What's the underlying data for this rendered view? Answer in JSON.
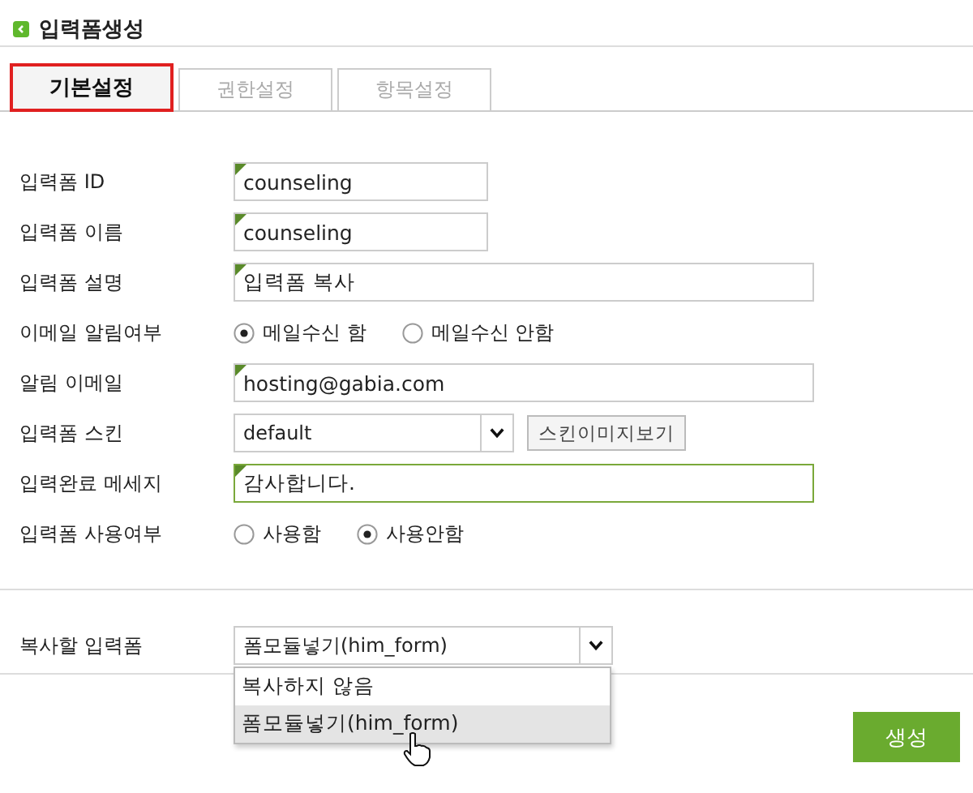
{
  "title": "입력폼생성",
  "tabs": [
    {
      "label": "기본설정",
      "selected": true
    },
    {
      "label": "권한설정",
      "selected": false
    },
    {
      "label": "항목설정",
      "selected": false
    }
  ],
  "fields": [
    {
      "kind": "short",
      "label": "입력폼 ID",
      "value": "counseling",
      "focused": false
    },
    {
      "kind": "short",
      "label": "입력폼 이름",
      "value": "counseling",
      "focused": false
    },
    {
      "kind": "long",
      "label": "입력폼 설명",
      "value": "입력폼 복사",
      "focused": false
    },
    {
      "kind": "radio",
      "label": "이메일 알림여부",
      "options": [
        {
          "label": "메일수신 함",
          "selected": true
        },
        {
          "label": "메일수신 안함",
          "selected": false
        }
      ]
    },
    {
      "kind": "long",
      "label": "알림 이메일",
      "value": "hosting@gabia.com",
      "focused": false
    },
    {
      "kind": "select",
      "label": "입력폼 스킨",
      "value": "default",
      "button": "스킨이미지보기"
    },
    {
      "kind": "long",
      "label": "입력완료 메세지",
      "value": "감사합니다.",
      "focused": true
    },
    {
      "kind": "radio",
      "label": "입력폼 사용여부",
      "options": [
        {
          "label": "사용함",
          "selected": false
        },
        {
          "label": "사용안함",
          "selected": true
        }
      ]
    }
  ],
  "copy": {
    "label": "복사할 입력폼",
    "value": "폼모듈넣기(him_form)",
    "expanded": true,
    "options": [
      {
        "label": "복사하지 않음",
        "selected": false
      },
      {
        "label": "폼모듈넣기(him_form)",
        "selected": true
      }
    ]
  },
  "submit": "생성"
}
